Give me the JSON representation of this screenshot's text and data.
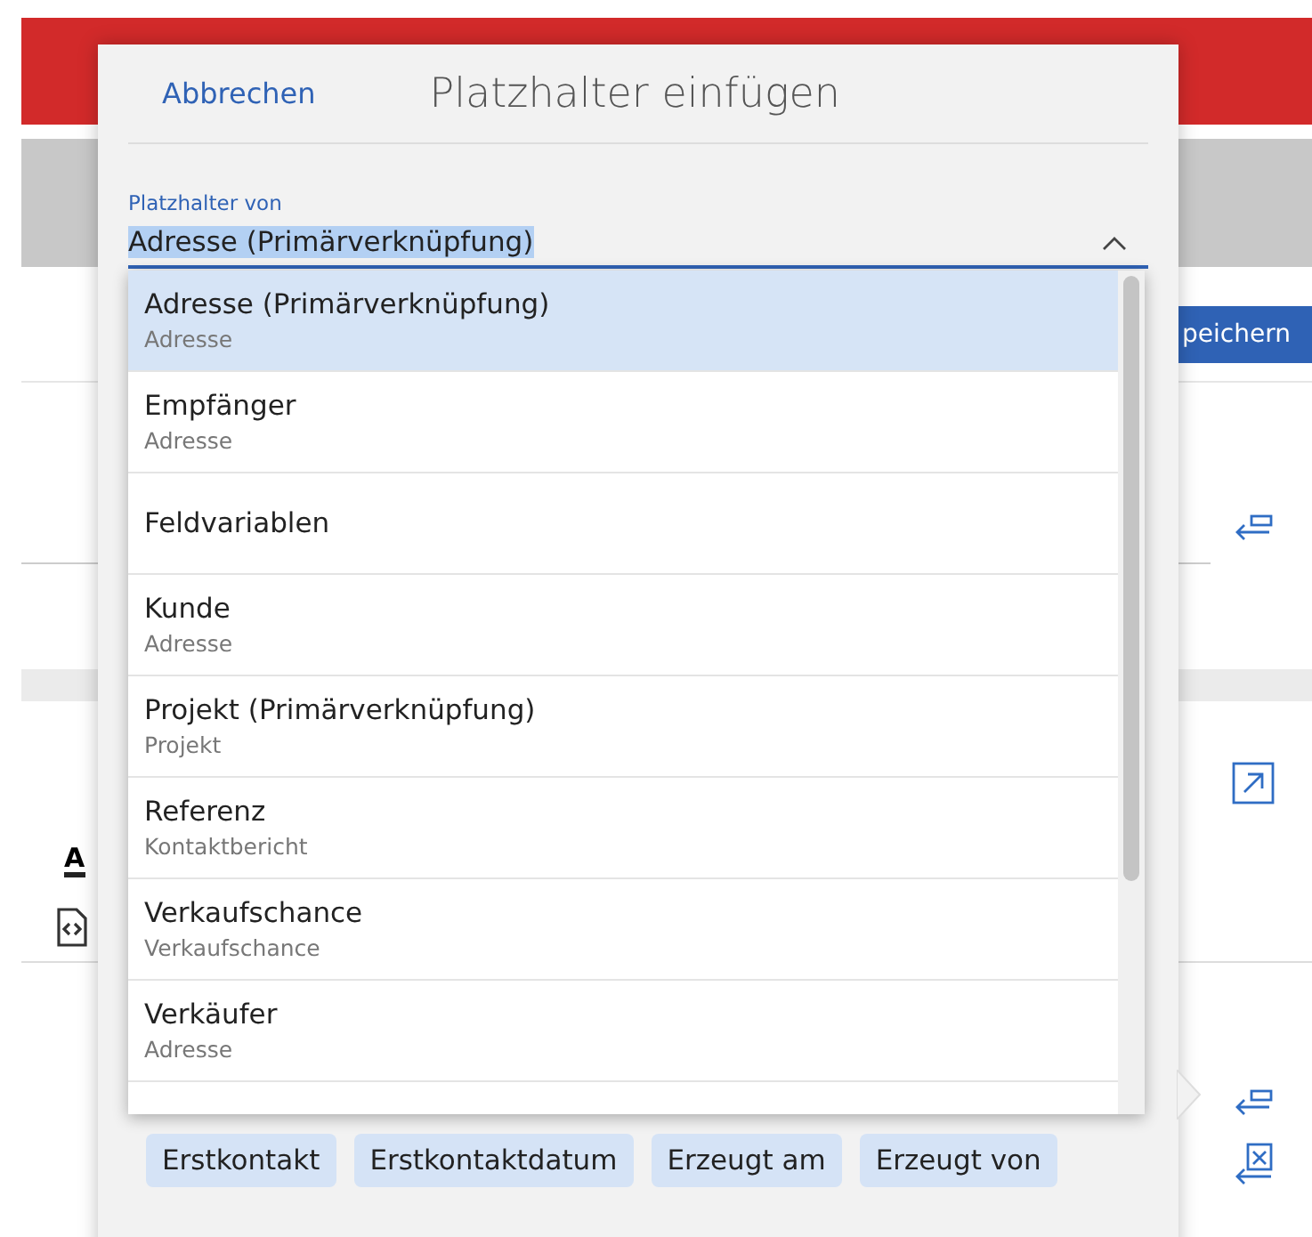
{
  "background": {
    "save_button": "peichern",
    "toolbar_letter": "A"
  },
  "dialog": {
    "cancel": "Abbrechen",
    "title": "Platzhalter einfügen",
    "field": {
      "label": "Platzhalter von",
      "value": "Adresse (Primärverknüpfung)",
      "expanded": true
    },
    "options": [
      {
        "title": "Adresse (Primärverknüpfung)",
        "subtitle": "Adresse",
        "selected": true
      },
      {
        "title": "Empfänger",
        "subtitle": "Adresse",
        "selected": false
      },
      {
        "title": "Feldvariablen",
        "selected": false
      },
      {
        "title": "Kunde",
        "subtitle": "Adresse",
        "selected": false
      },
      {
        "title": "Projekt (Primärverknüpfung)",
        "subtitle": "Projekt",
        "selected": false
      },
      {
        "title": "Referenz",
        "subtitle": "Kontaktbericht",
        "selected": false
      },
      {
        "title": "Verkaufschance",
        "subtitle": "Verkaufschance",
        "selected": false
      },
      {
        "title": "Verkäufer",
        "subtitle": "Adresse",
        "selected": false
      }
    ],
    "chip_rows": [
      [
        "Erstkontakt",
        "Erstkontaktdatum",
        "Erzeugt am",
        "Erzeugt von"
      ]
    ]
  }
}
